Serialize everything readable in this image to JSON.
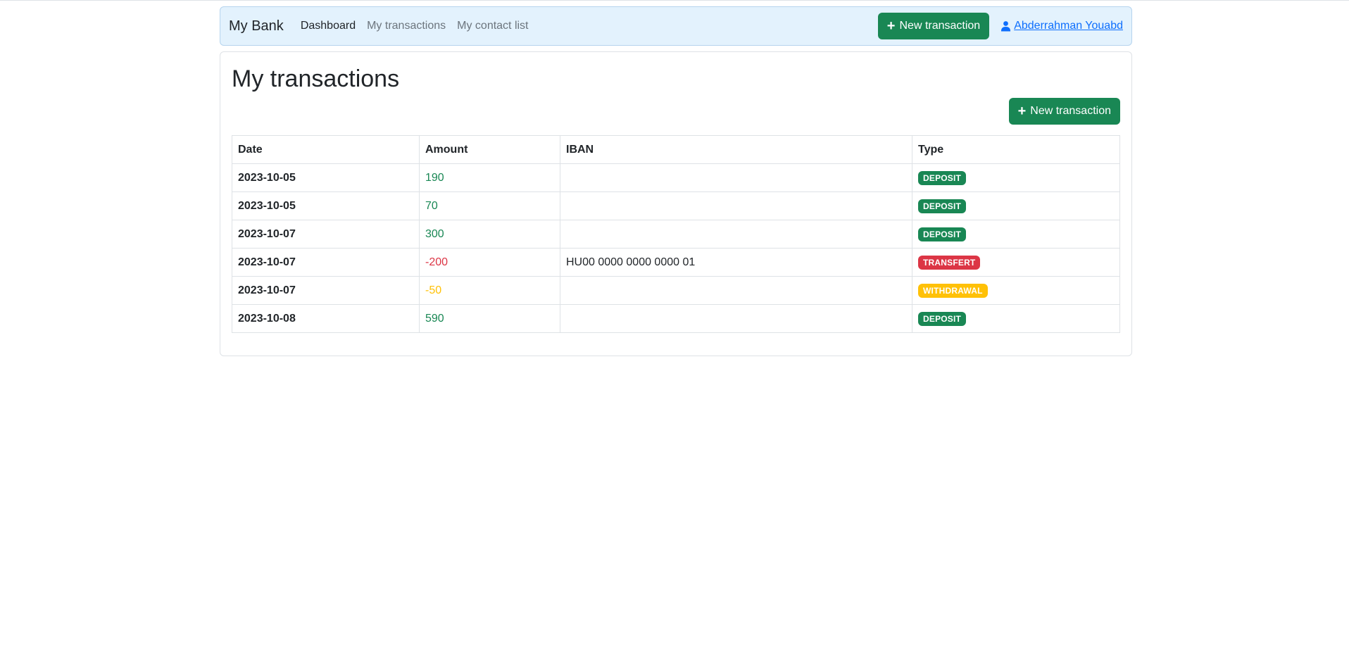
{
  "navbar": {
    "brand": "My Bank",
    "links": [
      "Dashboard",
      "My transactions",
      "My contact list"
    ],
    "new_transaction_label": "New transaction",
    "user_name": "Abderrahman Youabd"
  },
  "page": {
    "title": "My transactions",
    "new_transaction_label": "New transaction"
  },
  "table": {
    "headers": [
      "Date",
      "Amount",
      "IBAN",
      "Type"
    ],
    "rows": [
      {
        "date": "2023-10-05",
        "amount": "190",
        "iban": "",
        "type": "DEPOSIT"
      },
      {
        "date": "2023-10-05",
        "amount": "70",
        "iban": "",
        "type": "DEPOSIT"
      },
      {
        "date": "2023-10-07",
        "amount": "300",
        "iban": "",
        "type": "DEPOSIT"
      },
      {
        "date": "2023-10-07",
        "amount": "-200",
        "iban": "HU00 0000 0000 0000 01",
        "type": "TRANSFERT"
      },
      {
        "date": "2023-10-07",
        "amount": "-50",
        "iban": "",
        "type": "WITHDRAWAL"
      },
      {
        "date": "2023-10-08",
        "amount": "590",
        "iban": "",
        "type": "DEPOSIT"
      }
    ]
  },
  "colors": {
    "deposit": "#198754",
    "transfert": "#dc3545",
    "withdrawal": "#ffc107",
    "link": "#0d6efd",
    "navbar_bg": "#e3f2fd"
  },
  "icons": {
    "plus": "plus-icon",
    "user": "user-icon"
  }
}
